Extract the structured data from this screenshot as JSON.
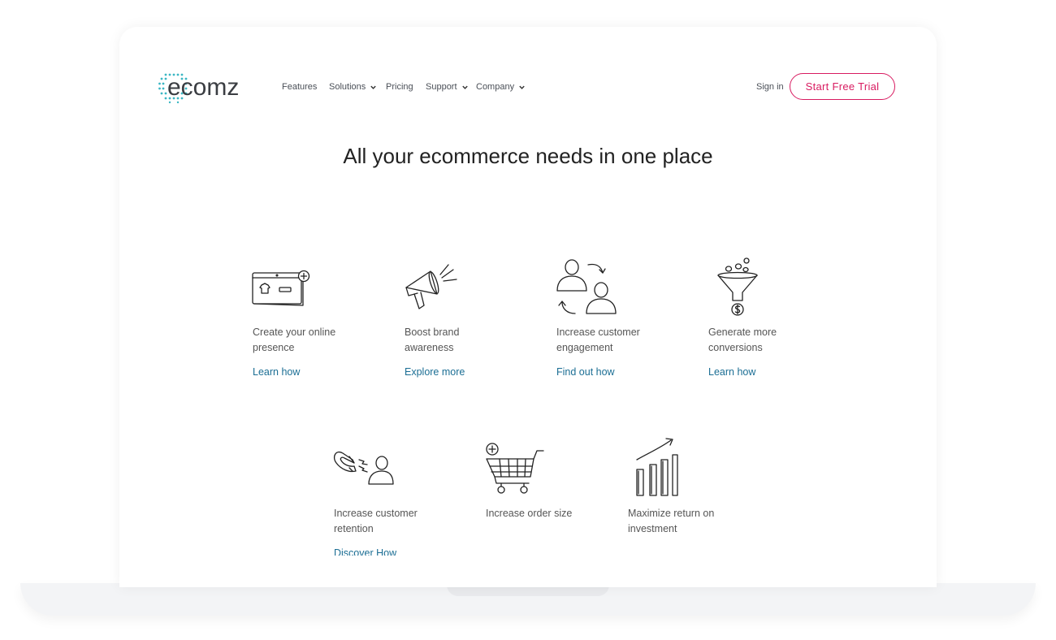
{
  "logo": {
    "text": "ecomz"
  },
  "nav": {
    "items": [
      {
        "label": "Features"
      },
      {
        "label": "Solutions"
      },
      {
        "label": "Pricing"
      },
      {
        "label": "Support"
      },
      {
        "label": "Company"
      }
    ],
    "sign_in": "Sign in",
    "cta": "Start Free Trial"
  },
  "hero": {
    "title": "All your ecommerce needs in one place"
  },
  "features_row1": [
    {
      "label": "Create your online presence",
      "link": "Learn how"
    },
    {
      "label": "Boost brand awareness",
      "link": "Explore more"
    },
    {
      "label": "Increase customer engagement",
      "link": "Find out how"
    },
    {
      "label": "Generate more conversions",
      "link": "Learn how"
    }
  ],
  "features_row2": [
    {
      "label": "Increase customer retention",
      "link": "Discover How"
    },
    {
      "label": "Increase order size"
    },
    {
      "label": "Maximize return on investment"
    }
  ],
  "colors": {
    "accent": "#d81b60",
    "link": "#1b6e94",
    "logo_dots": "#3bb7c4"
  }
}
